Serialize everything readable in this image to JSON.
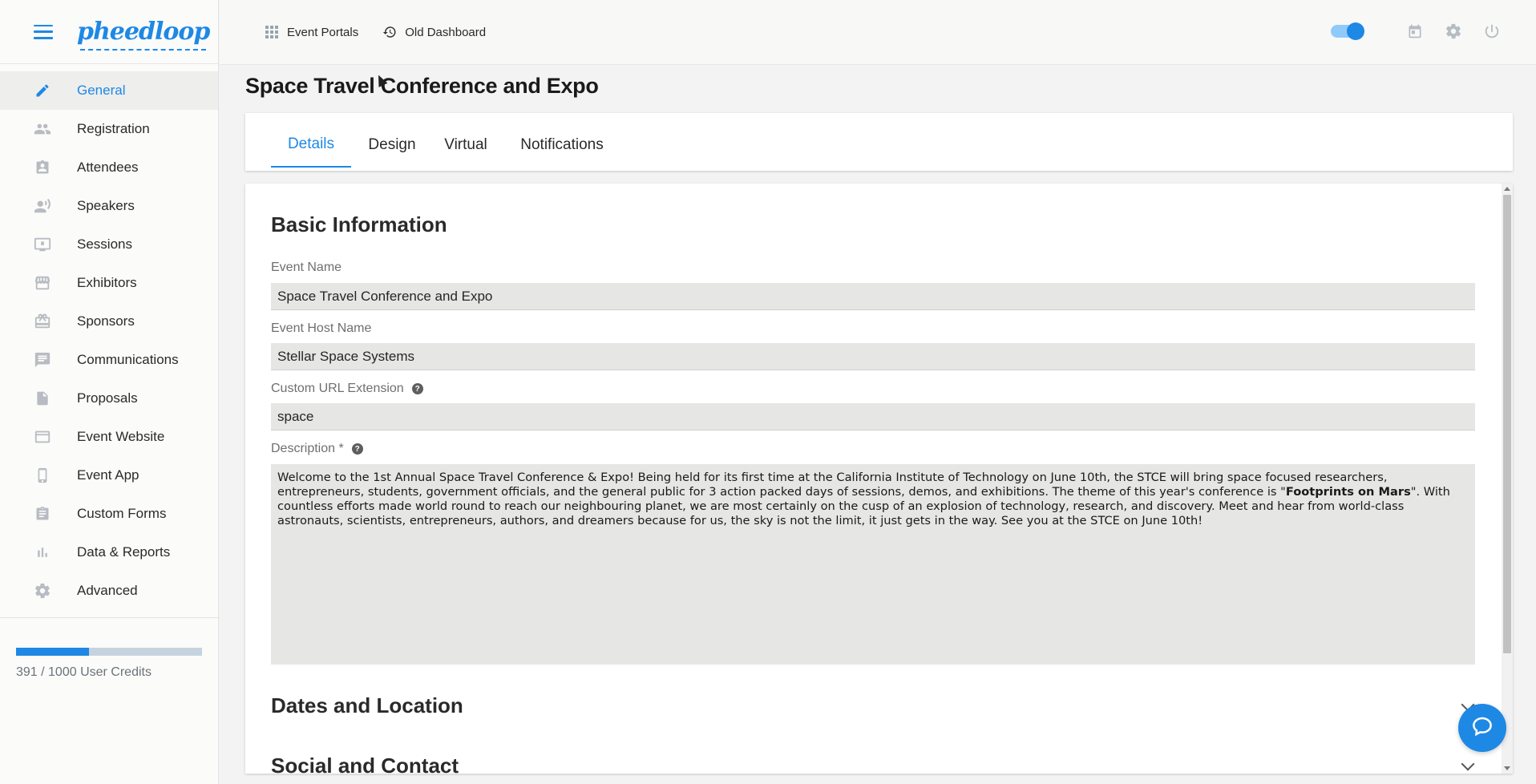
{
  "app": {
    "logo": "pheedloop"
  },
  "colors": {
    "accent": "#1e88e5",
    "sidebar_bg": "#fbfbfa",
    "field_bg": "#e6e6e4"
  },
  "topbar": {
    "links": [
      {
        "label": "Event Portals",
        "icon": "grid-icon"
      },
      {
        "label": "Old Dashboard",
        "icon": "history-icon"
      }
    ],
    "toggle_on": true,
    "icons": [
      "calendar-icon",
      "gear-icon",
      "power-icon"
    ]
  },
  "sidebar": {
    "items": [
      {
        "label": "General",
        "icon": "pencil-icon",
        "active": true
      },
      {
        "label": "Registration",
        "icon": "people-icon"
      },
      {
        "label": "Attendees",
        "icon": "badge-icon"
      },
      {
        "label": "Speakers",
        "icon": "speaker-icon"
      },
      {
        "label": "Sessions",
        "icon": "presentation-icon"
      },
      {
        "label": "Exhibitors",
        "icon": "storefront-icon"
      },
      {
        "label": "Sponsors",
        "icon": "gift-icon"
      },
      {
        "label": "Communications",
        "icon": "chat-icon"
      },
      {
        "label": "Proposals",
        "icon": "document-icon"
      },
      {
        "label": "Event Website",
        "icon": "browser-icon"
      },
      {
        "label": "Event App",
        "icon": "phone-icon"
      },
      {
        "label": "Custom Forms",
        "icon": "clipboard-icon"
      },
      {
        "label": "Data & Reports",
        "icon": "bar-chart-icon"
      },
      {
        "label": "Advanced",
        "icon": "gear-icon"
      }
    ],
    "credits": {
      "text": "391 / 1000 User Credits",
      "used": 391,
      "total": 1000
    }
  },
  "main": {
    "title": "Space Travel Conference and Expo",
    "tabs": [
      {
        "label": "Details",
        "active": true
      },
      {
        "label": "Design"
      },
      {
        "label": "Virtual"
      },
      {
        "label": "Notifications"
      }
    ],
    "basic": {
      "title": "Basic Information",
      "event_name_label": "Event Name",
      "event_name_value": "Space Travel Conference and Expo",
      "host_label": "Event Host Name",
      "host_value": "Stellar Space Systems",
      "url_label": "Custom URL Extension",
      "url_value": "space",
      "description_label": "Description *",
      "description_part1": "Welcome to the 1st Annual Space Travel Conference & Expo! Being held for its first time at the California Institute of Technology on June 10th, the STCE will bring space focused researchers, entrepreneurs, students, government officials, and the general public for 3 action packed days of sessions, demos, and exhibitions. The theme of this year's conference is \"",
      "description_bold": "Footprints on Mars",
      "description_part2": "\". With countless efforts made world round to reach our neighbouring planet, we are most certainly on the cusp of an explosion of technology, research, and discovery. Meet and hear from world-class astronauts, scientists, entrepreneurs, authors, and dreamers because for us, the sky is not the limit, it just gets in the way. See you at the STCE on June 10th!"
    },
    "sections": [
      {
        "title": "Dates and Location"
      },
      {
        "title": "Social and Contact"
      }
    ]
  }
}
